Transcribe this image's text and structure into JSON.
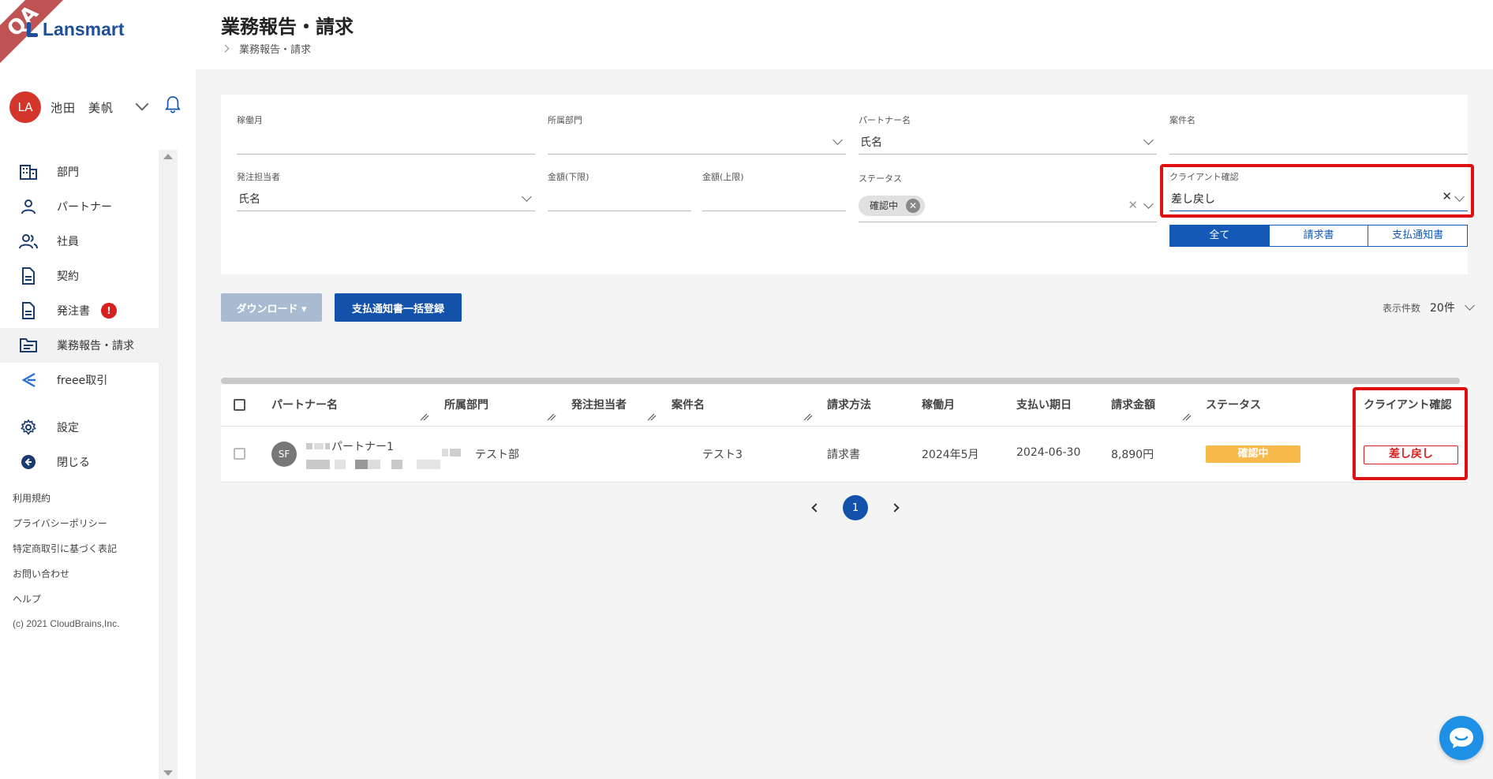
{
  "ribbon": "QA",
  "app": {
    "logo_text": "Lansmart"
  },
  "user": {
    "initials": "LA",
    "name": "池田　美帆"
  },
  "nav": [
    {
      "label": "部門",
      "icon": "building-icon"
    },
    {
      "label": "パートナー",
      "icon": "person-icon"
    },
    {
      "label": "社員",
      "icon": "people-icon"
    },
    {
      "label": "契約",
      "icon": "document-icon"
    },
    {
      "label": "発注書",
      "icon": "document-icon",
      "badge": "!"
    },
    {
      "label": "業務報告・請求",
      "icon": "folder-icon",
      "active": true
    },
    {
      "label": "freee取引",
      "icon": "freee-icon"
    },
    {
      "label": "設定",
      "icon": "gear-icon"
    },
    {
      "label": "閉じる",
      "icon": "arrow-left-circle-icon"
    }
  ],
  "footer_links": [
    "利用規約",
    "プライバシーポリシー",
    "特定商取引に基づく表記",
    "お問い合わせ",
    "ヘルプ"
  ],
  "copyright": "(c) 2021 CloudBrains,Inc.",
  "header": {
    "title": "業務報告・請求",
    "breadcrumb": "業務報告・請求"
  },
  "filters": {
    "work_month": {
      "label": "稼働月",
      "value": ""
    },
    "department": {
      "label": "所属部門",
      "value": ""
    },
    "partner_name": {
      "label": "パートナー名",
      "value": "氏名"
    },
    "project_name": {
      "label": "案件名",
      "value": ""
    },
    "orderer": {
      "label": "発注担当者",
      "value": "氏名"
    },
    "amount_min": {
      "label": "金額(下限)",
      "value": ""
    },
    "amount_max": {
      "label": "金額(上限)",
      "value": ""
    },
    "status": {
      "label": "ステータス",
      "chip": "確認中"
    },
    "client_confirm": {
      "label": "クライアント確認",
      "value": "差し戻し"
    },
    "doc_type_tabs": [
      {
        "label": "全て",
        "selected": true
      },
      {
        "label": "請求書",
        "selected": false
      },
      {
        "label": "支払通知書",
        "selected": false
      }
    ]
  },
  "actions": {
    "download_label": "ダウンロード ▾",
    "bulk_label": "支払通知書一括登録",
    "per_page_label": "表示件数",
    "per_page_value": "20件"
  },
  "table": {
    "columns": [
      "パートナー名",
      "所属部門",
      "発注担当者",
      "案件名",
      "請求方法",
      "稼働月",
      "支払い期日",
      "請求金額",
      "ステータス",
      "クライアント確認"
    ],
    "rows": [
      {
        "avatar": "SF",
        "partner": "パートナー1",
        "department": "テスト部",
        "orderer": "",
        "project": "テスト3",
        "billing_method": "請求書",
        "work_month": "2024年5月",
        "due_date": "2024-06-30",
        "amount": "8,890円",
        "status": "確認中",
        "client_confirm": "差し戻し"
      }
    ]
  },
  "pagination": {
    "current": "1"
  },
  "colors": {
    "primary": "#1352aa",
    "danger": "#d61f1f",
    "warning": "#f7b94a",
    "highlight": "#e01010"
  }
}
